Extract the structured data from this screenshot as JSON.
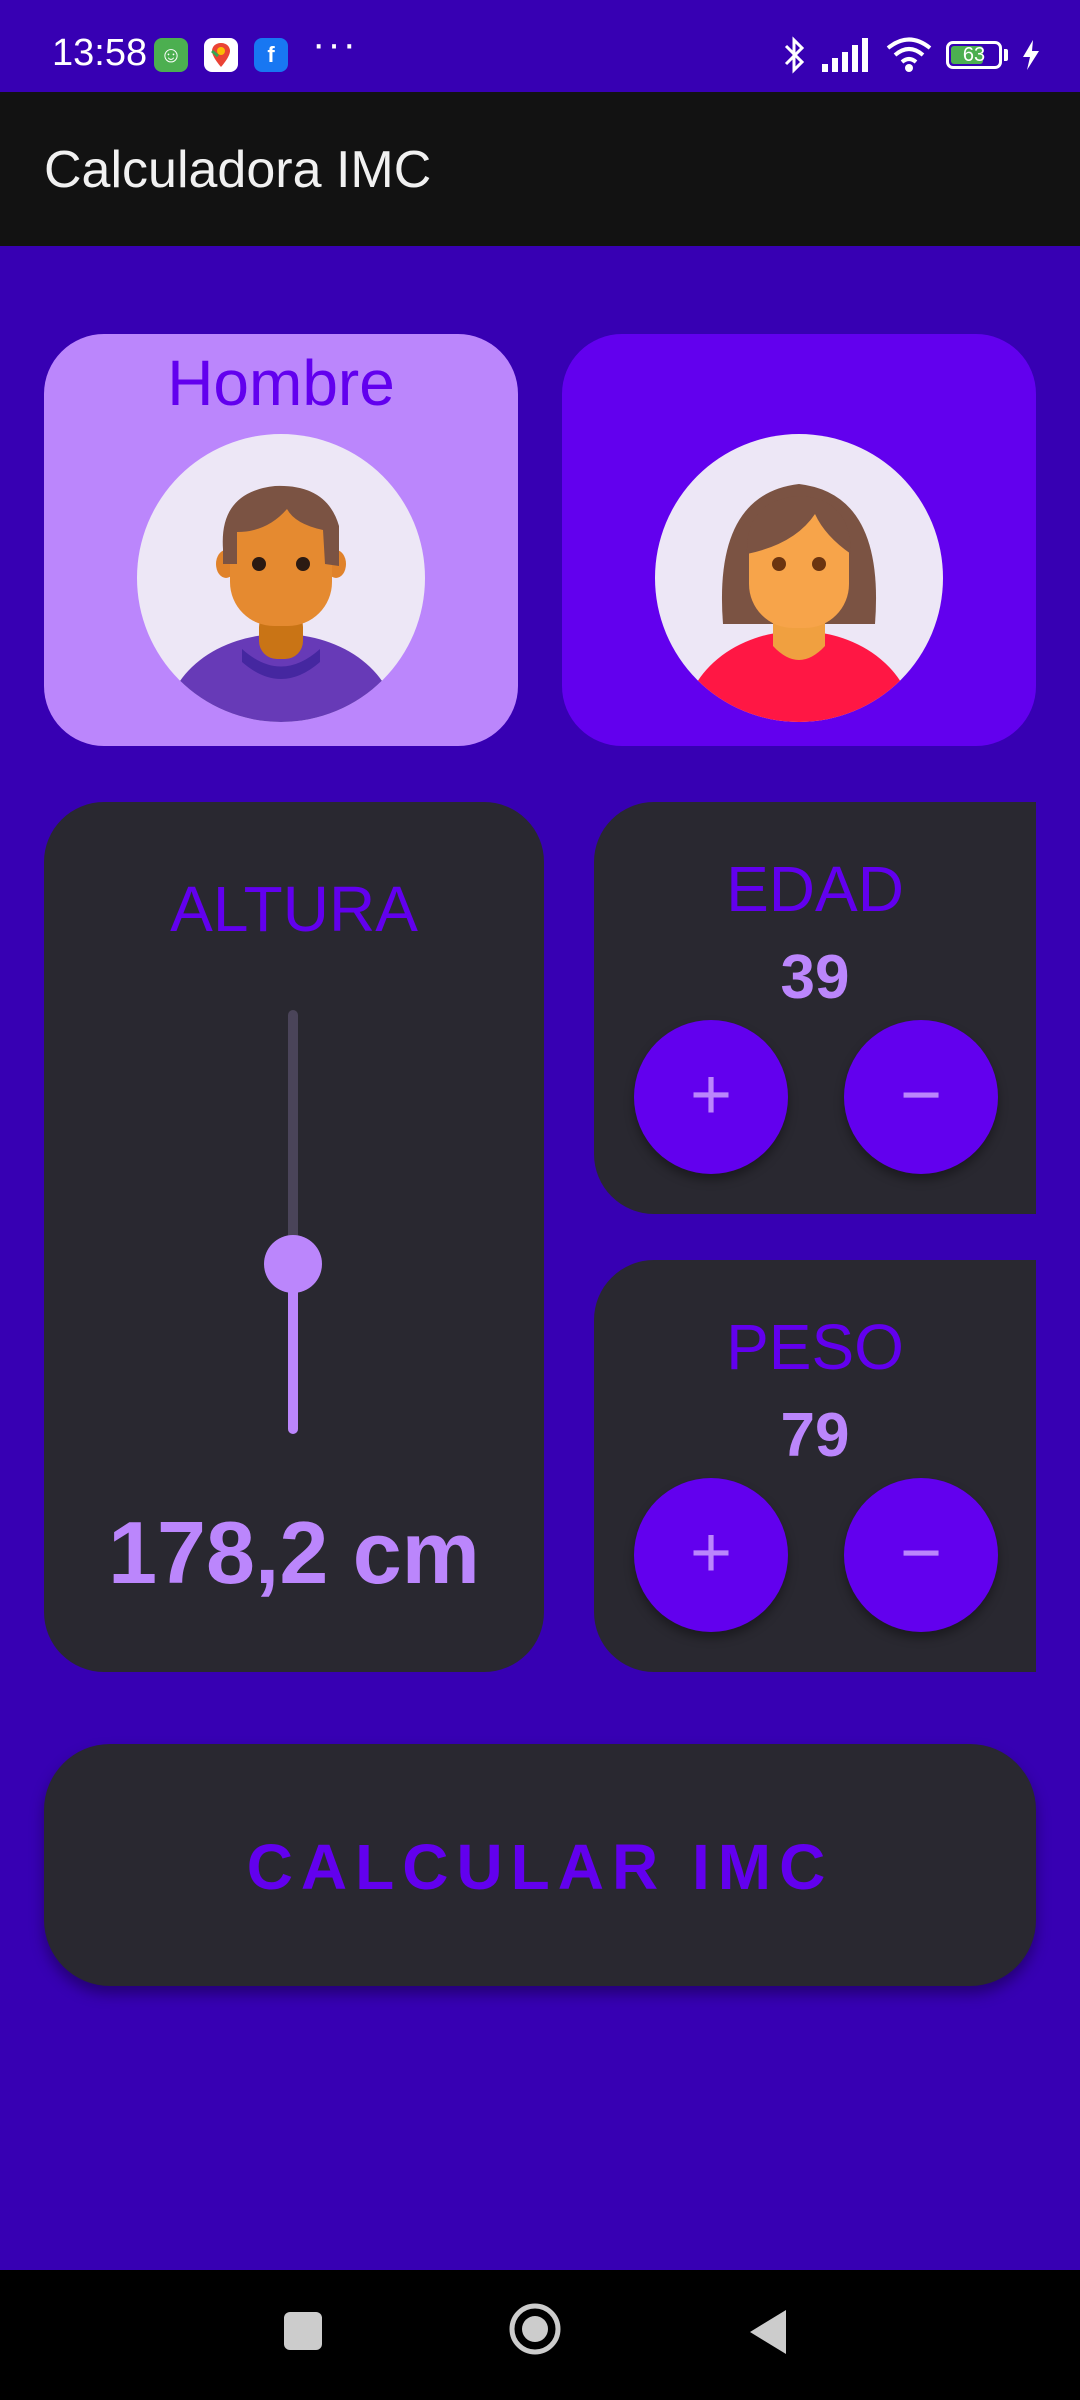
{
  "status_bar": {
    "time": "13:58",
    "battery": "63",
    "icons": [
      "cat-app-icon",
      "maps-icon",
      "facebook-icon",
      "more-notifications-icon",
      "bluetooth-icon",
      "signal-icon",
      "wifi-icon",
      "battery-icon",
      "charging-icon"
    ],
    "overflow": "···"
  },
  "app_bar": {
    "title": "Calculadora IMC"
  },
  "gender": {
    "male": {
      "label": "Hombre",
      "selected": true
    },
    "female": {
      "label": "",
      "selected": false
    }
  },
  "altura": {
    "title": "ALTURA",
    "value_label": "178,2 cm",
    "slider_fraction": 0.4
  },
  "edad": {
    "title": "EDAD",
    "value": "39",
    "plus": "+",
    "minus": "−"
  },
  "peso": {
    "title": "PESO",
    "value": "79",
    "plus": "+",
    "minus": "−"
  },
  "calcular": {
    "label": "CALCULAR IMC"
  },
  "colors": {
    "background": "#3700b3",
    "primary": "#6200ee",
    "accent": "#bb86fc",
    "panel": "#292830",
    "app_bar": "#121212"
  }
}
